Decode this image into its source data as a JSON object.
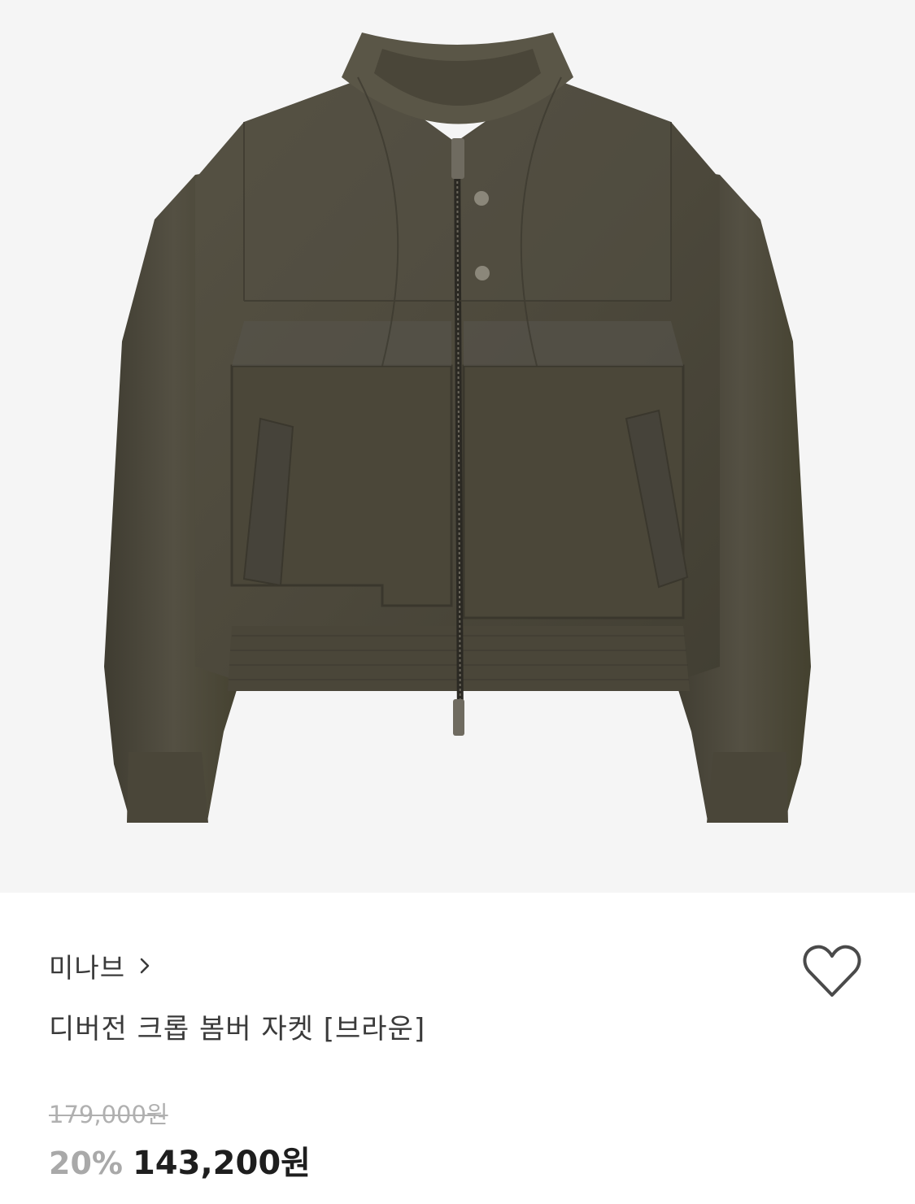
{
  "product": {
    "brand": "미나브",
    "title": "디버전 크롭 봄버 자켓 [브라운]",
    "original_price": "179,000원",
    "discount_rate": "20%",
    "sale_price": "143,200원"
  },
  "icons": {
    "brand_chevron": "chevron-right-icon",
    "wishlist": "heart-outline-icon"
  },
  "colors": {
    "jacket": "#4e4a3e",
    "background": "#f5f5f5",
    "text_primary": "#1e1e1e",
    "text_secondary": "#3a3a3a",
    "text_muted": "#a9a9a9"
  }
}
